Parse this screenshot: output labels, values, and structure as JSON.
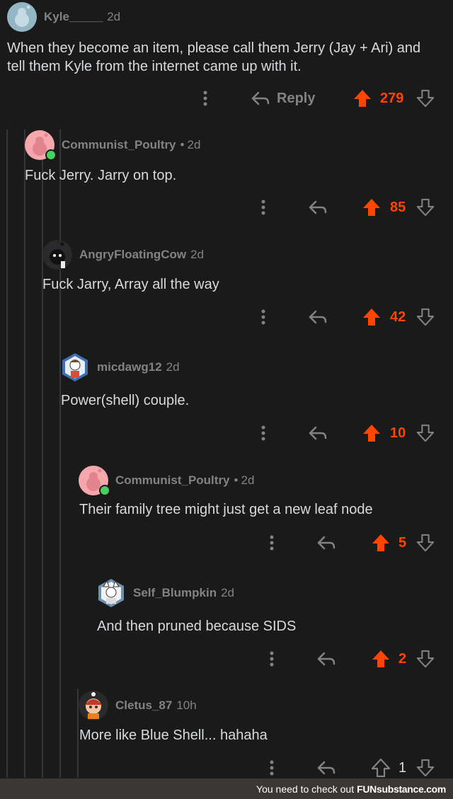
{
  "colors": {
    "background": "#1a1a1b",
    "upvoted": "#ff4500",
    "muted": "#818384",
    "text": "#d7dadc",
    "online": "#46d160",
    "threadline": "#343536"
  },
  "root": {
    "username": "Kyle_____",
    "age": "2d",
    "body": "When they become an item, please call them Jerry (Jay + Ari) and tell them Kyle from the internet came up with it.",
    "reply_label": "Reply",
    "score": "279",
    "avatar_icon": "snoo-avatar-icon"
  },
  "comments": [
    {
      "username": "Communist_Poultry",
      "separator": "•",
      "age": "2d",
      "body": "Fuck Jerry. Jarry on top.",
      "score": "85",
      "online": true
    },
    {
      "username": "AngryFloatingCow",
      "age": "2d",
      "body": "Fuck Jarry, Array all the way",
      "score": "42"
    },
    {
      "username": "micdawg12",
      "age": "2d",
      "body": "Power(shell) couple.",
      "score": "10"
    },
    {
      "username": "Communist_Poultry",
      "separator": "•",
      "age": "2d",
      "body": "Their family tree might just get a new leaf node",
      "score": "5",
      "online": true
    },
    {
      "username": "Self_Blumpkin",
      "age": "2d",
      "body": "And then pruned because SIDS",
      "score": "2"
    },
    {
      "username": "Cletus_87",
      "age": "10h",
      "body": "More like Blue Shell... hahaha",
      "score": "1"
    }
  ],
  "footer": {
    "text": "You need to check out",
    "brand": "FUNsubstance.com"
  }
}
